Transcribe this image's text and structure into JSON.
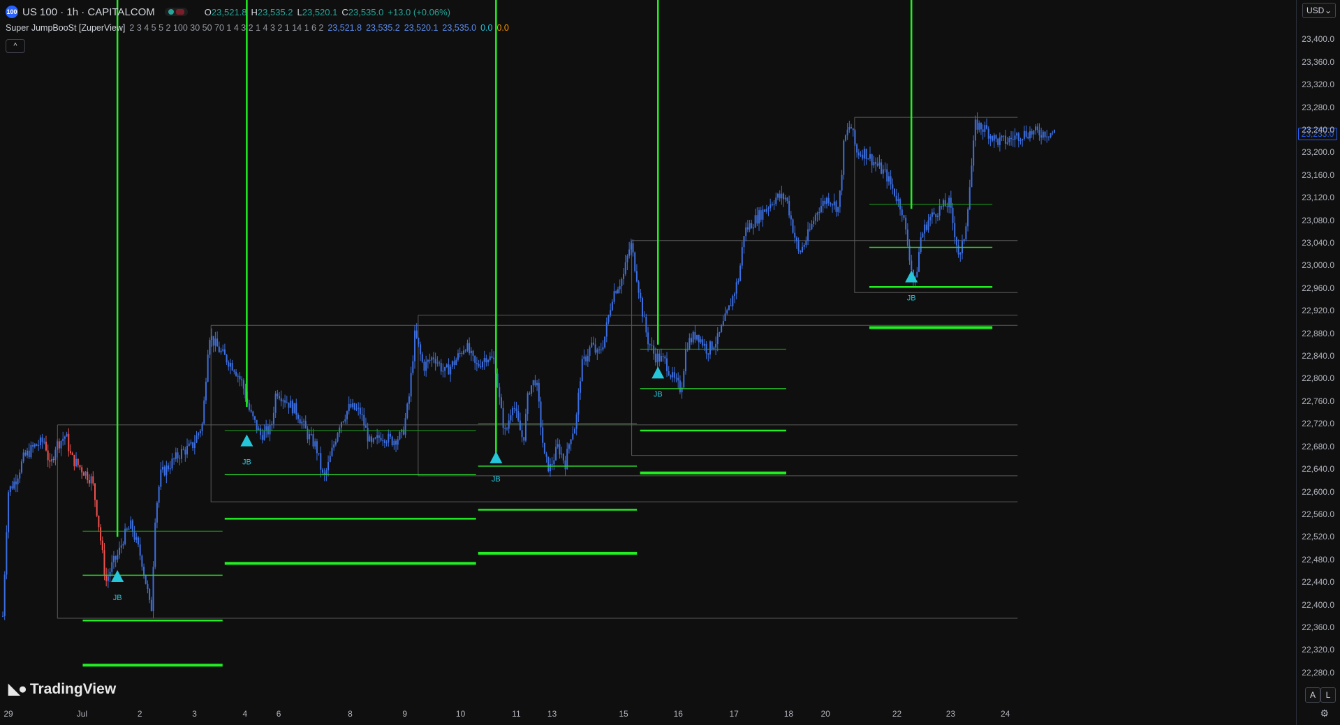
{
  "header": {
    "symbol_badge": "100",
    "title": "US 100 · 1h · CAPITALCOM",
    "ohlc": [
      {
        "k": "O",
        "v": "23,521.8"
      },
      {
        "k": "H",
        "v": "23,535.2"
      },
      {
        "k": "L",
        "v": "23,520.1"
      },
      {
        "k": "C",
        "v": "23,535.0"
      },
      {
        "k": "",
        "v": "+13.0 (+0.06%)"
      }
    ]
  },
  "indicator": {
    "name": "Super JumpBooSt [ZuperView]",
    "params": "2 3 4 5 5 2 100 30 50 70 1 4 3 2 1 4 3 2 1 14 1 6 2",
    "values": [
      "23,521.8",
      "23,535.2",
      "23,520.1",
      "23,535.0",
      "0.0",
      "0.0"
    ]
  },
  "collapse_label": "^",
  "currency": "USD",
  "last_price": "23,233.0",
  "brand": "TradingView",
  "scale_buttons": [
    "A",
    "L"
  ],
  "colors": {
    "background": "#0f0f0f",
    "candle_blue": "#3d6fe0",
    "candle_red": "#ef5350",
    "signal_green": "#22ee22",
    "jb_marker": "#26c6da"
  },
  "chart_data": {
    "type": "candlestick",
    "symbol": "US 100",
    "interval": "1h",
    "ylim": [
      22260,
      23430
    ],
    "y_ticks": [
      23400,
      23360,
      23320,
      23280,
      23240,
      23200,
      23160,
      23120,
      23080,
      23040,
      23000,
      22960,
      22920,
      22880,
      22840,
      22800,
      22760,
      22720,
      22680,
      22640,
      22600,
      22560,
      22520,
      22480,
      22440,
      22400,
      22360,
      22320,
      22280
    ],
    "y_tick_labels": [
      "23,400.0",
      "23,360.0",
      "23,320.0",
      "23,280.0",
      "23,240.0",
      "23,200.0",
      "23,160.0",
      "23,120.0",
      "23,080.0",
      "23,040.0",
      "23,000.0",
      "22,960.0",
      "22,920.0",
      "22,880.0",
      "22,840.0",
      "22,800.0",
      "22,760.0",
      "22,720.0",
      "22,680.0",
      "22,640.0",
      "22,600.0",
      "22,560.0",
      "22,520.0",
      "22,480.0",
      "22,440.0",
      "22,400.0",
      "22,360.0",
      "22,320.0",
      "22,280.0"
    ],
    "x_ticks": [
      {
        "label": "29",
        "t": 0.0
      },
      {
        "label": "Jul",
        "t": 0.07
      },
      {
        "label": "2",
        "t": 0.125
      },
      {
        "label": "3",
        "t": 0.177
      },
      {
        "label": "4",
        "t": 0.225
      },
      {
        "label": "6",
        "t": 0.257
      },
      {
        "label": "8",
        "t": 0.325
      },
      {
        "label": "9",
        "t": 0.377
      },
      {
        "label": "10",
        "t": 0.43
      },
      {
        "label": "11",
        "t": 0.483
      },
      {
        "label": "13",
        "t": 0.517
      },
      {
        "label": "15",
        "t": 0.585
      },
      {
        "label": "16",
        "t": 0.637
      },
      {
        "label": "17",
        "t": 0.69
      },
      {
        "label": "18",
        "t": 0.742
      },
      {
        "label": "20",
        "t": 0.777
      },
      {
        "label": "22",
        "t": 0.845
      },
      {
        "label": "23",
        "t": 0.896
      },
      {
        "label": "24",
        "t": 0.948
      }
    ],
    "price_path": [
      [
        0.0,
        22380
      ],
      [
        0.005,
        22600
      ],
      [
        0.012,
        22620
      ],
      [
        0.02,
        22660
      ],
      [
        0.03,
        22680
      ],
      [
        0.04,
        22690
      ],
      [
        0.045,
        22640
      ],
      [
        0.05,
        22680
      ],
      [
        0.06,
        22700
      ],
      [
        0.065,
        22660
      ],
      [
        0.075,
        22640
      ],
      [
        0.085,
        22620
      ],
      [
        0.09,
        22560
      ],
      [
        0.094,
        22500
      ],
      [
        0.098,
        22440
      ],
      [
        0.104,
        22470
      ],
      [
        0.11,
        22490
      ],
      [
        0.115,
        22520
      ],
      [
        0.122,
        22540
      ],
      [
        0.127,
        22510
      ],
      [
        0.132,
        22480
      ],
      [
        0.138,
        22420
      ],
      [
        0.141,
        22380
      ],
      [
        0.145,
        22560
      ],
      [
        0.15,
        22630
      ],
      [
        0.16,
        22650
      ],
      [
        0.17,
        22670
      ],
      [
        0.18,
        22680
      ],
      [
        0.19,
        22720
      ],
      [
        0.196,
        22880
      ],
      [
        0.202,
        22860
      ],
      [
        0.21,
        22840
      ],
      [
        0.22,
        22820
      ],
      [
        0.228,
        22790
      ],
      [
        0.235,
        22740
      ],
      [
        0.245,
        22700
      ],
      [
        0.255,
        22710
      ],
      [
        0.26,
        22780
      ],
      [
        0.27,
        22760
      ],
      [
        0.28,
        22740
      ],
      [
        0.29,
        22700
      ],
      [
        0.298,
        22680
      ],
      [
        0.305,
        22620
      ],
      [
        0.31,
        22650
      ],
      [
        0.32,
        22720
      ],
      [
        0.33,
        22750
      ],
      [
        0.34,
        22740
      ],
      [
        0.35,
        22680
      ],
      [
        0.36,
        22700
      ],
      [
        0.37,
        22690
      ],
      [
        0.38,
        22700
      ],
      [
        0.386,
        22760
      ],
      [
        0.392,
        22880
      ],
      [
        0.4,
        22820
      ],
      [
        0.41,
        22840
      ],
      [
        0.42,
        22810
      ],
      [
        0.43,
        22830
      ],
      [
        0.44,
        22860
      ],
      [
        0.45,
        22820
      ],
      [
        0.46,
        22840
      ],
      [
        0.468,
        22830
      ],
      [
        0.473,
        22750
      ],
      [
        0.478,
        22700
      ],
      [
        0.485,
        22760
      ],
      [
        0.49,
        22720
      ],
      [
        0.495,
        22690
      ],
      [
        0.5,
        22780
      ],
      [
        0.507,
        22800
      ],
      [
        0.515,
        22660
      ],
      [
        0.52,
        22640
      ],
      [
        0.528,
        22680
      ],
      [
        0.535,
        22650
      ],
      [
        0.54,
        22700
      ],
      [
        0.545,
        22720
      ],
      [
        0.55,
        22820
      ],
      [
        0.56,
        22860
      ],
      [
        0.566,
        22840
      ],
      [
        0.572,
        22870
      ],
      [
        0.58,
        22950
      ],
      [
        0.59,
        22980
      ],
      [
        0.597,
        23040
      ],
      [
        0.603,
        22980
      ],
      [
        0.608,
        22920
      ],
      [
        0.613,
        22870
      ],
      [
        0.62,
        22840
      ],
      [
        0.63,
        22830
      ],
      [
        0.637,
        22800
      ],
      [
        0.645,
        22780
      ],
      [
        0.65,
        22860
      ],
      [
        0.66,
        22880
      ],
      [
        0.67,
        22850
      ],
      [
        0.68,
        22870
      ],
      [
        0.69,
        22920
      ],
      [
        0.7,
        22980
      ],
      [
        0.705,
        23060
      ],
      [
        0.715,
        23080
      ],
      [
        0.725,
        23100
      ],
      [
        0.735,
        23120
      ],
      [
        0.745,
        23120
      ],
      [
        0.752,
        23060
      ],
      [
        0.757,
        23020
      ],
      [
        0.765,
        23050
      ],
      [
        0.775,
        23100
      ],
      [
        0.785,
        23120
      ],
      [
        0.795,
        23100
      ],
      [
        0.8,
        23220
      ],
      [
        0.806,
        23250
      ],
      [
        0.812,
        23200
      ],
      [
        0.82,
        23200
      ],
      [
        0.83,
        23180
      ],
      [
        0.84,
        23160
      ],
      [
        0.845,
        23140
      ],
      [
        0.855,
        23100
      ],
      [
        0.862,
        23020
      ],
      [
        0.867,
        22960
      ],
      [
        0.873,
        23050
      ],
      [
        0.88,
        23080
      ],
      [
        0.89,
        23100
      ],
      [
        0.9,
        23110
      ],
      [
        0.905,
        23060
      ],
      [
        0.91,
        23010
      ],
      [
        0.915,
        23060
      ],
      [
        0.92,
        23150
      ],
      [
        0.925,
        23250
      ],
      [
        0.935,
        23240
      ],
      [
        0.945,
        23220
      ],
      [
        0.955,
        23220
      ],
      [
        0.965,
        23230
      ],
      [
        0.975,
        23235
      ]
    ],
    "signals": [
      {
        "label": "JB",
        "t": 0.109,
        "price": 22450,
        "line_top_price": 23440,
        "line_bottom_price": 22520
      },
      {
        "label": "JB",
        "t": 0.232,
        "price": 22690,
        "line_top_price": 23440,
        "line_bottom_price": 22750
      },
      {
        "label": "JB",
        "t": 0.469,
        "price": 22660,
        "line_top_price": 23440,
        "line_bottom_price": 22660
      },
      {
        "label": "JB",
        "t": 0.623,
        "price": 22810,
        "line_top_price": 23440,
        "line_bottom_price": 22860
      },
      {
        "label": "JB",
        "t": 0.864,
        "price": 22980,
        "line_top_price": 23440,
        "line_bottom_price": 23100
      }
    ],
    "target_levels": [
      {
        "t0": 0.076,
        "t1": 0.209,
        "levels": [
          22530,
          22452,
          22372,
          22293
        ]
      },
      {
        "t0": 0.211,
        "t1": 0.45,
        "levels": [
          22708,
          22630,
          22552,
          22473
        ]
      },
      {
        "t0": 0.452,
        "t1": 0.603,
        "levels": [
          22720,
          22645,
          22568,
          22491
        ]
      },
      {
        "t0": 0.606,
        "t1": 0.745,
        "levels": [
          22852,
          22782,
          22708,
          22633
        ]
      },
      {
        "t0": 0.824,
        "t1": 0.941,
        "levels": [
          23108,
          23032,
          22962,
          22890
        ]
      }
    ],
    "range_boxes": [
      {
        "t0": 0.052,
        "t1": 0.965,
        "top": 22718,
        "bottom": 22376
      },
      {
        "t0": 0.198,
        "t1": 0.965,
        "top": 22894,
        "bottom": 22582
      },
      {
        "t0": 0.395,
        "t1": 0.965,
        "top": 22912,
        "bottom": 22628
      },
      {
        "t0": 0.598,
        "t1": 0.965,
        "top": 23044,
        "bottom": 22664
      },
      {
        "t0": 0.81,
        "t1": 0.965,
        "top": 23262,
        "bottom": 22952
      }
    ]
  }
}
